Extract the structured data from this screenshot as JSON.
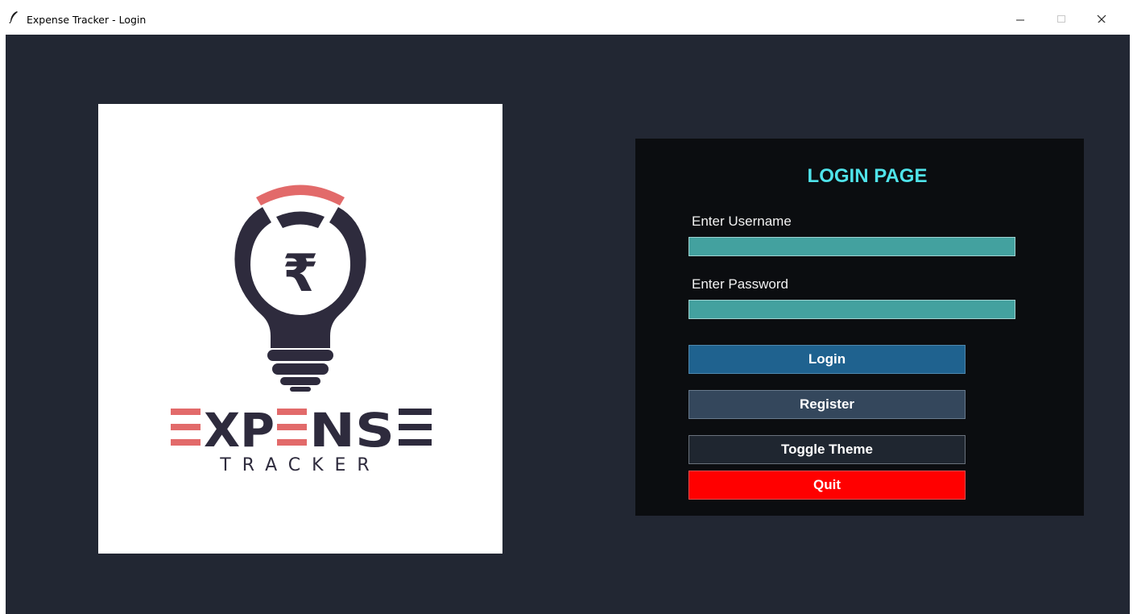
{
  "window": {
    "title": "Expense Tracker - Login",
    "controls": {
      "minimize": "minimize",
      "maximize": "maximize",
      "close": "close"
    }
  },
  "logo": {
    "brand_text": "EXPENSE",
    "sub_text": "TRACKER",
    "currency_symbol": "₹",
    "colors": {
      "dark": "#2e2b3d",
      "accent": "#e26a6a"
    }
  },
  "login": {
    "title": "LOGIN PAGE",
    "username_label": "Enter Username",
    "username_value": "",
    "password_label": "Enter Password",
    "password_value": "",
    "buttons": {
      "login": "Login",
      "register": "Register",
      "toggle_theme": "Toggle Theme",
      "quit": "Quit"
    }
  },
  "colors": {
    "background": "#222733",
    "panel": "#0b0d10",
    "title": "#4fe3ea",
    "input": "#43a19f",
    "login_button": "#1f628f",
    "register_button": "#34475c",
    "toggle_button": "#1f2630",
    "quit_button": "#ff0000"
  }
}
